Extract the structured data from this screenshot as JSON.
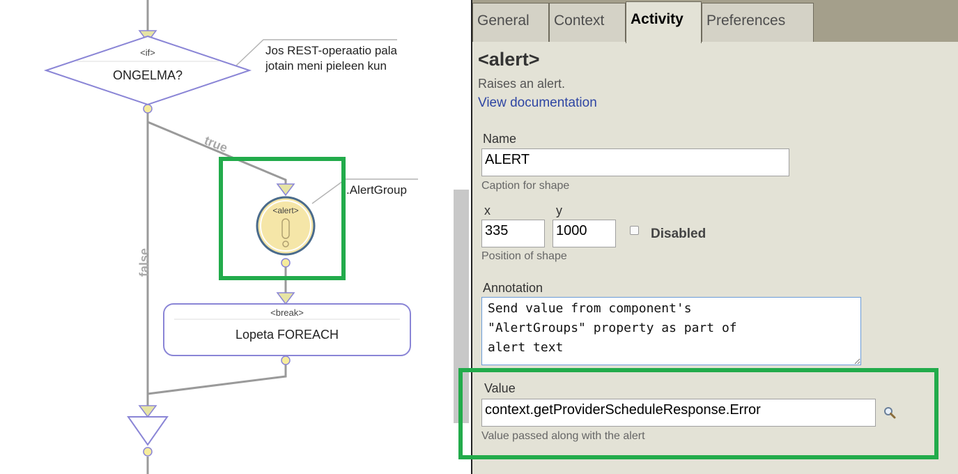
{
  "flow": {
    "if_node": {
      "tag": "<if>",
      "caption": "ONGELMA?"
    },
    "if_comment": {
      "line1": "Jos REST-operaatio pala",
      "line2": "jotain meni pieleen kun"
    },
    "edge_true": "true",
    "edge_false": "false",
    "alert_node": {
      "tag": "<alert>",
      "comment": ".AlertGroup"
    },
    "break_node": {
      "tag": "<break>",
      "caption": "Lopeta FOREACH"
    }
  },
  "tabs": [
    "General",
    "Context",
    "Activity",
    "Preferences"
  ],
  "active_tab": "Activity",
  "panel": {
    "title": "<alert>",
    "description": "Raises an alert.",
    "doc_link": "View documentation",
    "name": {
      "label": "Name",
      "value": "ALERT",
      "hint": "Caption for shape"
    },
    "position": {
      "x_label": "x",
      "y_label": "y",
      "x_value": "335",
      "y_value": "1000",
      "hint": "Position of shape"
    },
    "disabled": {
      "label": "Disabled",
      "checked": false
    },
    "annotation": {
      "label": "Annotation",
      "value": "Send value from component's\n\"AlertGroups\" property as part of\nalert text"
    },
    "value": {
      "label": "Value",
      "value": "context.getProviderScheduleResponse.Error",
      "hint": "Value passed along with the alert",
      "icon": "magnifier-icon"
    }
  },
  "colors": {
    "highlight": "#22ab4b",
    "node_stroke": "#8a85d6",
    "connector_fill": "#f6ec9c",
    "tab_strip": "#a49f8b",
    "panel_bg": "#e3e2d6"
  }
}
